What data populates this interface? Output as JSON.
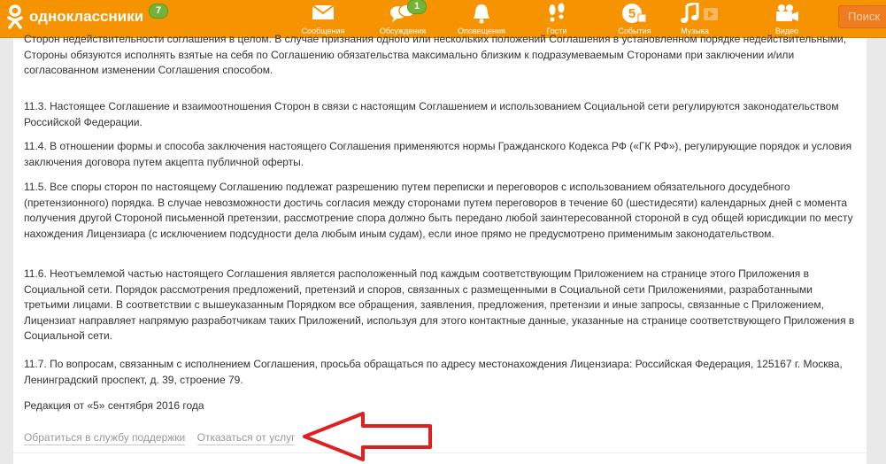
{
  "brand": {
    "name": "одноклассники",
    "badge": "7"
  },
  "nav": [
    {
      "label": "Сообщения",
      "icon": "envelope-icon",
      "badge": ""
    },
    {
      "label": "Обсуждения",
      "icon": "speech-bubbles-icon",
      "badge": "1"
    },
    {
      "label": "Оповещения",
      "icon": "bell-icon",
      "badge": ""
    },
    {
      "label": "Гости",
      "icon": "footprints-icon",
      "badge": ""
    },
    {
      "label": "События",
      "icon": "events-5-icon",
      "badge": ""
    },
    {
      "label": "Музыка",
      "icon": "music-note-icon",
      "badge": ""
    },
    {
      "label": "Видео",
      "icon": "video-camera-icon",
      "badge": ""
    }
  ],
  "search": {
    "label": "Поиск"
  },
  "paragraphs": [
    "Сторон недействительности соглашения в целом. В случае признания одного или нескольких положений Соглашения в установленном порядке недействительными, Стороны обязуются исполнять взятые на себя по Соглашению обязательства максимально близким к подразумеваемым Сторонами при заключении и/или согласованном изменении Соглашения способом.",
    "11.3. Настоящее Соглашение и взаимоотношения Сторон в связи с настоящим Соглашением и использованием Социальной сети регулируются законодательством Российской Федерации.",
    "11.4. В отношении формы и способа заключения настоящего Соглашения применяются нормы Гражданского Кодекса РФ («ГК РФ»), регулирующие порядок и условия заключения договора путем акцепта публичной оферты.",
    "11.5. Все споры сторон по настоящему Соглашению подлежат разрешению путем переписки и переговоров с использованием обязательного досудебного (претензионного) порядка. В случае невозможности достичь согласия между сторонами путем переговоров в течение 60 (шестидесяти) календарных дней с момента получения другой Стороной письменной претензии, рассмотрение спора должно быть передано любой заинтересованной стороной в суд общей юрисдикции по месту нахождения Лицензиара (с исключением подсудности дела любым иным судам), если иное прямо не предусмотрено применимым законодательством.",
    "11.6. Неотъемлемой частью настоящего Соглашения является расположенный под каждым соответствующим Приложением на странице этого Приложения в Социальной сети. Порядок рассмотрения предложений, претензий и споров, связанных с размещенными в Социальной сети Приложениями, разработанными третьими лицами. В соответствии с вышеуказанным Порядком все обращения, заявления, предложения, претензии и иные запросы, связанные с Приложением, Лицензиат направляет напрямую разработчикам таких Приложений, используя для этого контактные данные, указанные на странице соответствующего Приложения в Социальной сети.",
    "11.7. По вопросам, связанным с исполнением Соглашения, просьба обращаться по адресу местонахождения Лицензиара: Российская Федерация, 125167 г. Москва, Ленинградский проспект, д. 39, строение 79.",
    "Редакция от «5» сентября 2016 года"
  ],
  "links": {
    "support": "Обратиться в службу поддержки",
    "unsubscribe": "Отказаться от услуг"
  },
  "colors": {
    "brand": "#f59400",
    "badge": "#72b338",
    "arrow": "#e02020",
    "link": "#999999"
  }
}
